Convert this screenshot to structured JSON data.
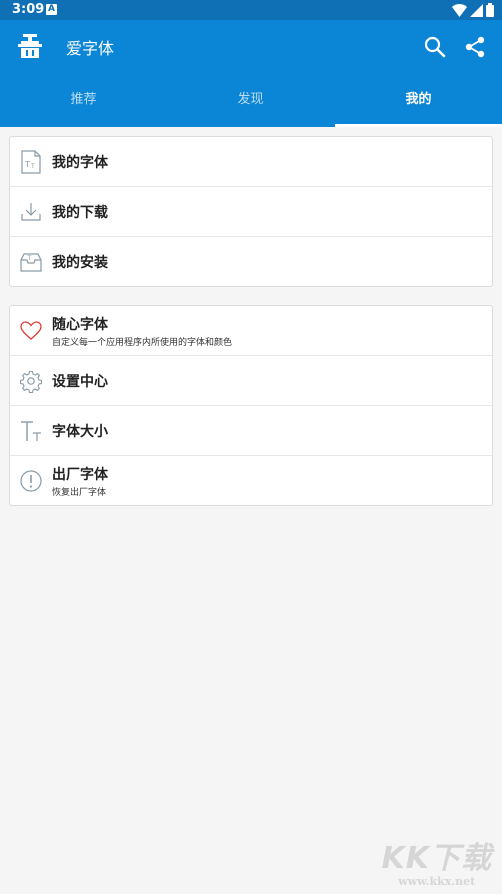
{
  "status": {
    "time": "3:09",
    "notification_glyph": "A"
  },
  "app": {
    "title": "爱字体"
  },
  "tabs": [
    {
      "label": "推荐",
      "active": false
    },
    {
      "label": "发现",
      "active": false
    },
    {
      "label": "我的",
      "active": true
    }
  ],
  "group1": [
    {
      "icon": "font-file-icon",
      "label": "我的字体"
    },
    {
      "icon": "download-icon",
      "label": "我的下载"
    },
    {
      "icon": "install-tray-icon",
      "label": "我的安装"
    }
  ],
  "group2": [
    {
      "icon": "heart-icon",
      "label": "随心字体",
      "sub": "自定义每一个应用程序内所使用的字体和颜色"
    },
    {
      "icon": "gear-icon",
      "label": "设置中心"
    },
    {
      "icon": "font-size-icon",
      "label": "字体大小"
    },
    {
      "icon": "info-icon",
      "label": "出厂字体",
      "sub": "恢复出厂字体"
    }
  ],
  "watermark": {
    "main": "KK下载",
    "url": "www.kkx.net"
  },
  "colors": {
    "status_bar": "#0f70b6",
    "app_bar": "#0b85d6",
    "background": "#f5f5f5",
    "heart": "#e53935",
    "icon_gray": "#8a9aa8"
  }
}
